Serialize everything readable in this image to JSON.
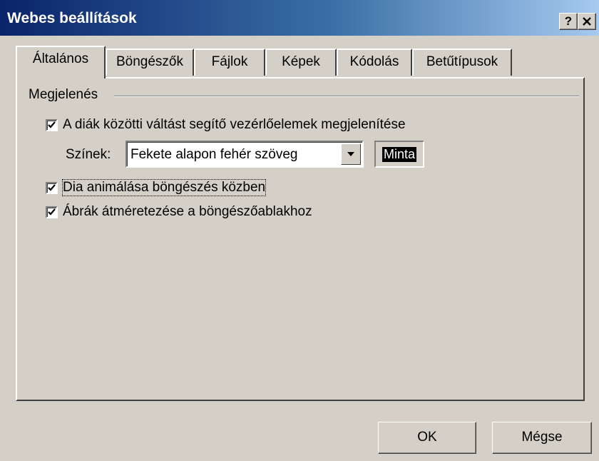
{
  "window": {
    "title": "Webes beállítások",
    "help_button": "?",
    "close_button": "✕"
  },
  "tabs": [
    {
      "label": "Általános",
      "active": true
    },
    {
      "label": "Böngészők",
      "active": false
    },
    {
      "label": "Fájlok",
      "active": false
    },
    {
      "label": "Képek",
      "active": false
    },
    {
      "label": "Kódolás",
      "active": false
    },
    {
      "label": "Betűtípusok",
      "active": false
    }
  ],
  "group": {
    "label": "Megjelenés"
  },
  "options": {
    "show_nav": {
      "label": "A diák közötti váltást segítő vezérlőelemek megjelenítése",
      "checked": true
    },
    "colors": {
      "label": "Színek:",
      "value": "Fekete alapon fehér szöveg",
      "sample": "Minta"
    },
    "animate": {
      "label": "Dia animálása böngészés közben",
      "checked": true
    },
    "resize": {
      "label": "Ábrák átméretezése a böngészőablakhoz",
      "checked": true
    }
  },
  "buttons": {
    "ok": "OK",
    "cancel": "Mégse"
  }
}
